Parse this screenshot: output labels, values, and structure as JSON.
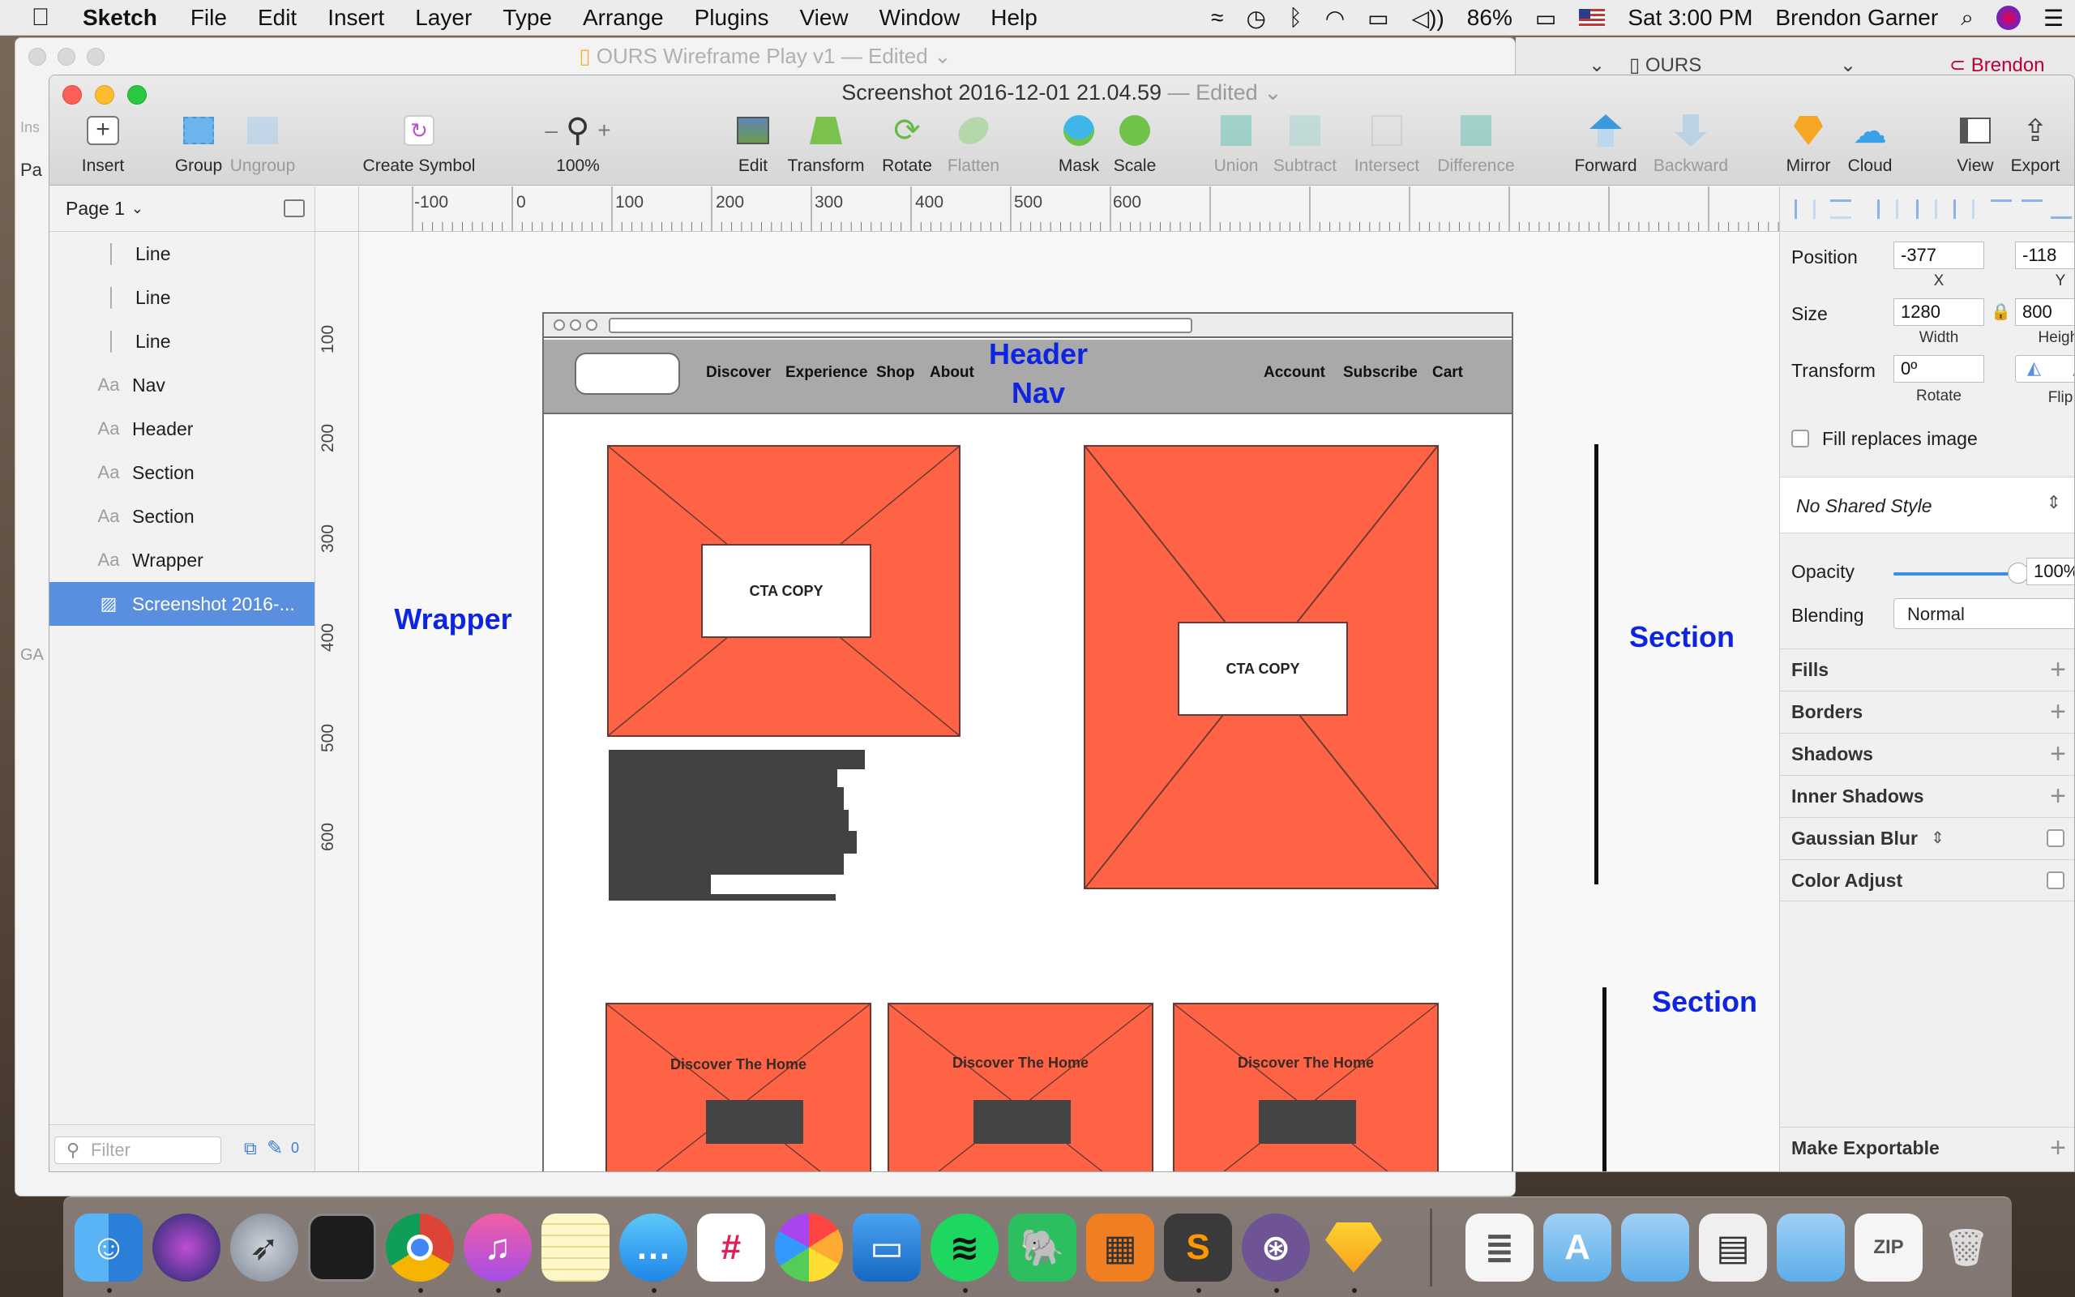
{
  "menubar": {
    "app": "Sketch",
    "items": [
      "File",
      "Edit",
      "Insert",
      "Layer",
      "Type",
      "Arrange",
      "Plugins",
      "View",
      "Window",
      "Help"
    ],
    "battery": "86%",
    "clock": "Sat 3:00 PM",
    "user": "Brendon Garner"
  },
  "bg_window": {
    "title": "OURS Wireframe Play v1",
    "status": "— Edited",
    "tab": "OURS",
    "profile": "Brendon",
    "side_labels": [
      "Ins",
      "Pa",
      "GA"
    ]
  },
  "window": {
    "title": "Screenshot 2016-12-01 21.04.59",
    "status": "— Edited"
  },
  "toolbar": {
    "insert": "Insert",
    "group": "Group",
    "ungroup": "Ungroup",
    "create_symbol": "Create Symbol",
    "zoom": "100%",
    "zoom_minus": "–",
    "zoom_plus": "+",
    "edit": "Edit",
    "transform": "Transform",
    "rotate": "Rotate",
    "flatten": "Flatten",
    "mask": "Mask",
    "scale": "Scale",
    "union": "Union",
    "subtract": "Subtract",
    "intersect": "Intersect",
    "difference": "Difference",
    "forward": "Forward",
    "backward": "Backward",
    "mirror": "Mirror",
    "cloud": "Cloud",
    "view": "View",
    "export": "Export"
  },
  "layers": {
    "page": "Page 1",
    "items": [
      {
        "icon": "line",
        "label": "Line"
      },
      {
        "icon": "line",
        "label": "Line"
      },
      {
        "icon": "line",
        "label": "Line"
      },
      {
        "icon": "text",
        "label": "Nav"
      },
      {
        "icon": "text",
        "label": "Header"
      },
      {
        "icon": "text",
        "label": "Section"
      },
      {
        "icon": "text",
        "label": "Section"
      },
      {
        "icon": "text",
        "label": "Wrapper"
      },
      {
        "icon": "image",
        "label": "Screenshot 2016-...",
        "selected": true
      }
    ],
    "text_icon": "Aa",
    "filter_placeholder": "Filter",
    "filter_count": "0"
  },
  "rulers": {
    "top": [
      "-100",
      "0",
      "100",
      "200",
      "300",
      "400",
      "500",
      "600"
    ],
    "left": [
      "100",
      "200",
      "300",
      "400",
      "500",
      "600"
    ],
    "corner_mark": "1"
  },
  "artboard": {
    "nav_left": [
      "Discover",
      "Experience",
      "Shop",
      "About"
    ],
    "nav_right": [
      "Account",
      "Subscribe",
      "Cart"
    ],
    "cta1": "CTA COPY",
    "cta2": "CTA COPY",
    "card_titles": [
      "Discover The Home",
      "Discover The Home",
      "Discover The Home"
    ]
  },
  "annotations": {
    "header": "Header",
    "nav": "Nav",
    "wrapper": "Wrapper",
    "section1": "Section",
    "section2": "Section",
    "color": "#0d25e0"
  },
  "inspector": {
    "position_label": "Position",
    "x_value": "-377",
    "y_value": "-118",
    "x_label": "X",
    "y_label": "Y",
    "size_label": "Size",
    "width_value": "1280",
    "height_value": "800",
    "width_label": "Width",
    "height_label": "Height",
    "transform_label": "Transform",
    "rotate_value": "0º",
    "rotate_label": "Rotate",
    "flip_label": "Flip",
    "fill_replaces": "Fill replaces image",
    "shared_style": "No Shared Style",
    "opacity_label": "Opacity",
    "opacity_value": "100%",
    "opacity": 1.0,
    "blending_label": "Blending",
    "blending_value": "Normal",
    "sections": [
      "Fills",
      "Borders",
      "Shadows",
      "Inner Shadows",
      "Gaussian Blur",
      "Color Adjust"
    ],
    "make_exportable": "Make Exportable"
  },
  "colors": {
    "placeholder": "#fe6346",
    "selection": "#5a8ede",
    "nav_bar": "#a9a9a9"
  },
  "dock": {
    "apps": [
      "finder-icon",
      "siri-icon",
      "launchpad-icon",
      "photo-booth-icon",
      "chrome-icon",
      "itunes-icon",
      "notes-icon",
      "messages-icon",
      "slack-icon",
      "photos-icon",
      "keynote-icon",
      "spotify-icon",
      "evernote-icon",
      "calculator-icon",
      "sublime-text-icon",
      "github-icon",
      "sketch-icon",
      "document-icon",
      "applications-folder-icon",
      "folder-icon",
      "screenshots-icon",
      "folder-icon",
      "zip-icon",
      "trash-icon"
    ]
  }
}
